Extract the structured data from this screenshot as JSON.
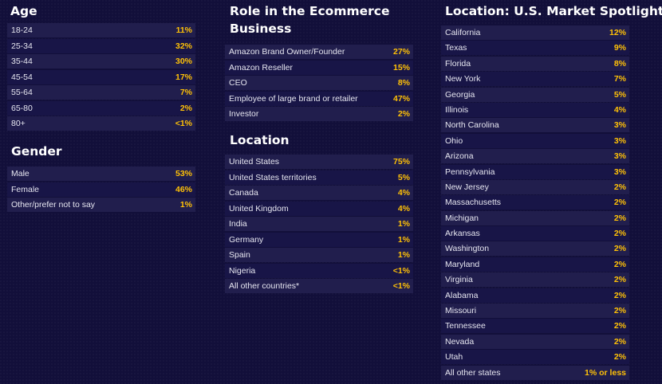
{
  "age": {
    "title": "Age",
    "rows": [
      {
        "label": "18-24",
        "value": "11%"
      },
      {
        "label": "25-34",
        "value": "32%"
      },
      {
        "label": "35-44",
        "value": "30%"
      },
      {
        "label": "45-54",
        "value": "17%"
      },
      {
        "label": "55-64",
        "value": "7%"
      },
      {
        "label": "65-80",
        "value": "2%"
      },
      {
        "label": "80+",
        "value": "<1%"
      }
    ]
  },
  "gender": {
    "title": "Gender",
    "rows": [
      {
        "label": "Male",
        "value": "53%"
      },
      {
        "label": "Female",
        "value": "46%"
      },
      {
        "label": "Other/prefer not to say",
        "value": "1%"
      }
    ]
  },
  "role": {
    "title_line1": "Role in the Ecommerce",
    "title_line2": "Business",
    "rows": [
      {
        "label": "Amazon Brand Owner/Founder",
        "value": "27%"
      },
      {
        "label": "Amazon Reseller",
        "value": "15%"
      },
      {
        "label": "CEO",
        "value": "8%"
      },
      {
        "label": "Employee of large brand or retailer",
        "value": "47%"
      },
      {
        "label": "Investor",
        "value": "2%"
      }
    ]
  },
  "location": {
    "title": "Location",
    "rows": [
      {
        "label": "United States",
        "value": "75%"
      },
      {
        "label": "United States territories",
        "value": "5%"
      },
      {
        "label": "Canada",
        "value": "4%"
      },
      {
        "label": "United Kingdom",
        "value": "4%"
      },
      {
        "label": "India",
        "value": "1%"
      },
      {
        "label": "Germany",
        "value": "1%"
      },
      {
        "label": "Spain",
        "value": "1%"
      },
      {
        "label": "Nigeria",
        "value": "<1%"
      },
      {
        "label": "All other countries*",
        "value": "<1%"
      }
    ]
  },
  "us_market": {
    "title": "Location: U.S. Market Spotlight",
    "rows": [
      {
        "label": "California",
        "value": "12%"
      },
      {
        "label": "Texas",
        "value": "9%"
      },
      {
        "label": "Florida",
        "value": "8%"
      },
      {
        "label": "New York",
        "value": "7%"
      },
      {
        "label": "Georgia",
        "value": "5%"
      },
      {
        "label": "Illinois",
        "value": "4%"
      },
      {
        "label": "North Carolina",
        "value": "3%"
      },
      {
        "label": "Ohio",
        "value": "3%"
      },
      {
        "label": "Arizona",
        "value": "3%"
      },
      {
        "label": "Pennsylvania",
        "value": "3%"
      },
      {
        "label": "New Jersey",
        "value": "2%"
      },
      {
        "label": "Massachusetts",
        "value": "2%"
      },
      {
        "label": "Michigan",
        "value": "2%"
      },
      {
        "label": "Arkansas",
        "value": "2%"
      },
      {
        "label": "Washington",
        "value": "2%"
      },
      {
        "label": "Maryland",
        "value": "2%"
      },
      {
        "label": "Virginia",
        "value": "2%"
      },
      {
        "label": "Alabama",
        "value": "2%"
      },
      {
        "label": "Missouri",
        "value": "2%"
      },
      {
        "label": "Tennessee",
        "value": "2%"
      },
      {
        "label": "Nevada",
        "value": "2%"
      },
      {
        "label": "Utah",
        "value": "2%"
      },
      {
        "label": "All other states",
        "value": "1% or less"
      }
    ]
  },
  "colors": {
    "background": "#120f3a",
    "row_odd": "#211e4d",
    "row_even": "#181547",
    "value": "#ffc107",
    "text": "#ffffff"
  }
}
